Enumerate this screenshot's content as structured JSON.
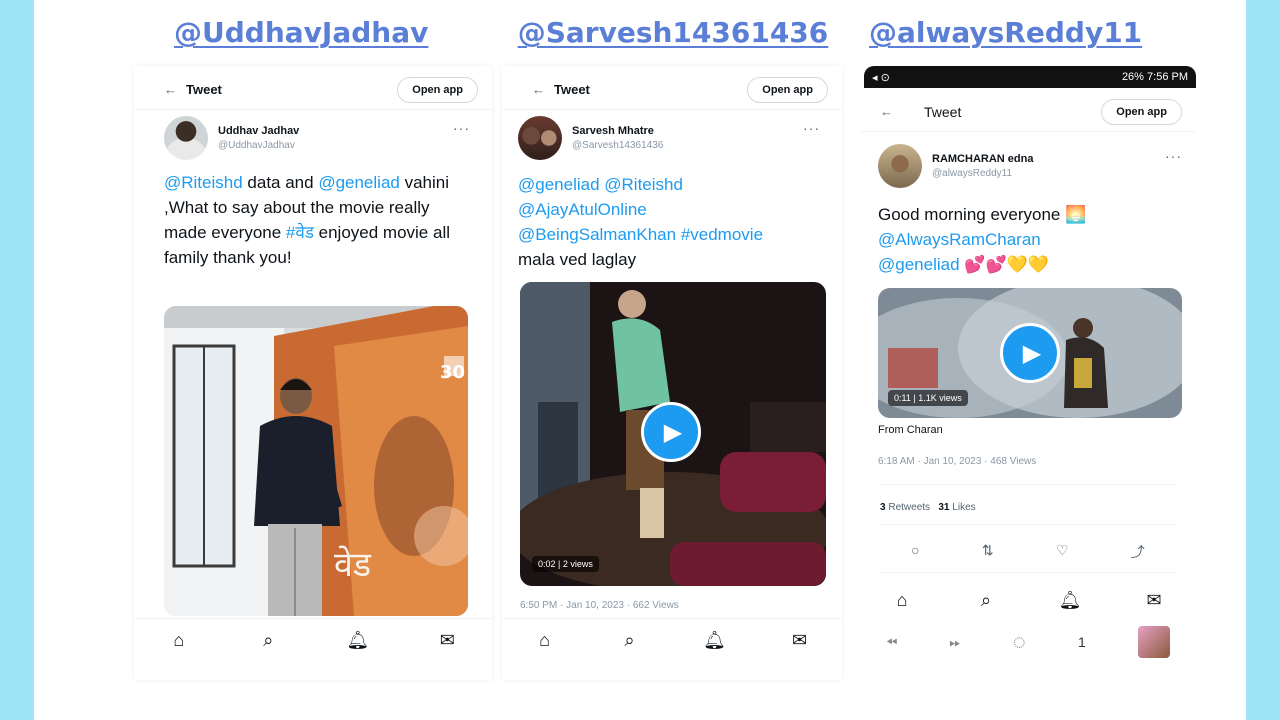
{
  "handles": [
    "@UddhavJadhav",
    "@Sarvesh14361436",
    "@alwaysReddy11"
  ],
  "tweet1": {
    "topbar_title": "Tweet",
    "open_app": "Open app",
    "author_name": "Uddhav Jadhav",
    "author_handle": "@UddhavJadhav",
    "text_mention1": "@Riteishd",
    "text_plain1": " data and ",
    "text_mention2": "@geneliad",
    "text_plain2": " vahini ,What to say about the movie really made everyone ",
    "text_hashtag": "#वेड",
    "text_plain3": " enjoyed movie all family thank you!",
    "poster_title": "वेड",
    "poster_days": "30"
  },
  "tweet2": {
    "topbar_title": "Tweet",
    "open_app": "Open app",
    "author_name": "Sarvesh Mhatre",
    "author_handle": "@Sarvesh14361436",
    "mentions_line1": "@geneliad @Riteishd",
    "mentions_line2": "@AjayAtulOnline",
    "mentions_line3a": "@BeingSalmanKhan",
    "mentions_line3b": " #vedmovie",
    "text_plain": "mala ved laglay",
    "video_badge": "0:02 | 2 views",
    "meta": "6:50 PM · Jan 10, 2023 · 662 Views"
  },
  "tweet3": {
    "status_time": "7:56 PM",
    "status_battery": "26%",
    "topbar_title": "Tweet",
    "open_app": "Open app",
    "author_name": "RAMCHARAN edna",
    "author_handle": "@alwaysReddy11",
    "text_plain": "Good morning everyone 🌅",
    "mention1": "@AlwaysRamCharan",
    "mention2": "@geneliad",
    "emojis": "💕💕💛💛",
    "video_badge": "0:11 | 1.1K views",
    "from": "From Charan",
    "meta": "6:18 AM · Jan 10, 2023 · 468 Views",
    "retweets_count": "3",
    "retweets_label": "Retweets",
    "likes_count": "31",
    "likes_label": "Likes",
    "page_number": "1"
  }
}
